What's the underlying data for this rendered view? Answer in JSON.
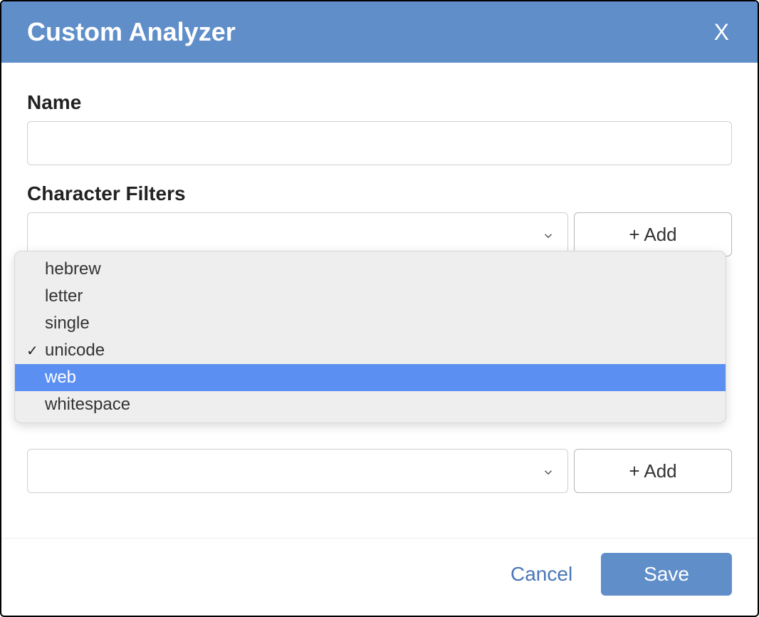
{
  "dialog": {
    "title": "Custom Analyzer",
    "close_label": "X"
  },
  "form": {
    "name_label": "Name",
    "name_value": "",
    "char_filters_label": "Character Filters",
    "char_filters_add": "+ Add",
    "lower_dropdown_value": "",
    "lower_add": "+ Add"
  },
  "dropdown": {
    "options": [
      {
        "label": "hebrew",
        "selected": false,
        "highlight": false
      },
      {
        "label": "letter",
        "selected": false,
        "highlight": false
      },
      {
        "label": "single",
        "selected": false,
        "highlight": false
      },
      {
        "label": "unicode",
        "selected": true,
        "highlight": false
      },
      {
        "label": "web",
        "selected": false,
        "highlight": true
      },
      {
        "label": "whitespace",
        "selected": false,
        "highlight": false
      }
    ]
  },
  "footer": {
    "cancel": "Cancel",
    "save": "Save"
  }
}
